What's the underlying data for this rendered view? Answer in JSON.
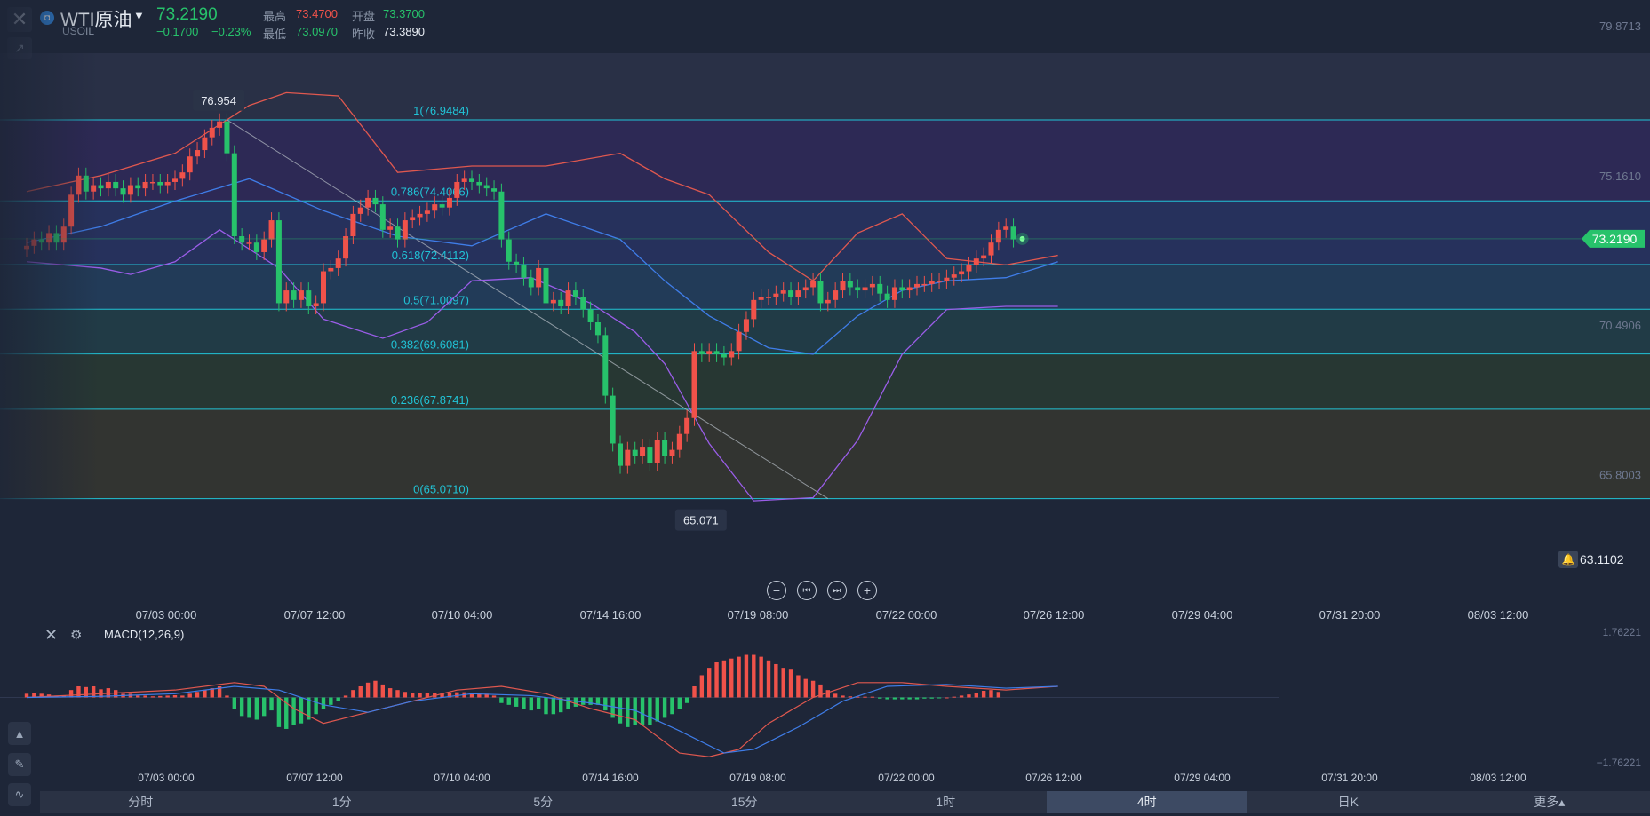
{
  "header": {
    "close_icon": "close-icon",
    "symbol_name": "WTI原油",
    "symbol_code": "USOIL",
    "last_price": "73.2190",
    "change": "−0.1700",
    "change_pct": "−0.23%",
    "high_label": "最高",
    "high_value": "73.4700",
    "open_label": "开盘",
    "open_value": "73.3700",
    "low_label": "最低",
    "low_value": "73.0970",
    "prev_close_label": "昨收",
    "prev_close_value": "73.3890"
  },
  "colors": {
    "up": "#f0524a",
    "down": "#27c26b",
    "bb_mid": "#3f7de8",
    "bb_upper": "#e0584f",
    "bb_lower": "#9a5de8",
    "fib": "#21c3d6",
    "macd_fast": "#3f7de8",
    "macd_slow": "#e0584f"
  },
  "chart_data": [
    {
      "type": "candlestick",
      "symbol": "WTI原油",
      "interval": "4时",
      "ylim": [
        63.1102,
        79.8713
      ],
      "y_axis_labels": [
        "79.8713",
        "75.1610",
        "70.4906",
        "65.8003"
      ],
      "y_axis_values": [
        79.8713,
        75.161,
        70.4906,
        65.8003
      ],
      "current_price_tag": "73.2190",
      "bottom_price_tag": "63.1102",
      "x_axis_labels": [
        "07/03 00:00",
        "07/07 12:00",
        "07/10 04:00",
        "07/14 16:00",
        "07/19 08:00",
        "07/22 00:00",
        "07/26 12:00",
        "07/29 04:00",
        "07/31 20:00",
        "08/03 12:00"
      ],
      "high_marker": "76.954",
      "low_marker": "65.071",
      "fibonacci": [
        {
          "label": "1(76.9484)",
          "value": 76.9484
        },
        {
          "label": "0.786(74.4066)",
          "value": 74.4066
        },
        {
          "label": "0.618(72.4112)",
          "value": 72.4112
        },
        {
          "label": "0.5(71.0097)",
          "value": 71.0097
        },
        {
          "label": "0.382(69.6081)",
          "value": 69.6081
        },
        {
          "label": "0.236(67.8741)",
          "value": 67.8741
        },
        {
          "label": "0(65.0710)",
          "value": 65.071
        }
      ],
      "close": [
        73.0,
        73.2,
        73.1,
        73.4,
        73.1,
        73.6,
        74.6,
        75.2,
        74.7,
        74.9,
        74.8,
        75.0,
        74.8,
        74.6,
        74.9,
        74.8,
        75.0,
        75.0,
        74.9,
        75.0,
        75.1,
        75.3,
        75.8,
        76.0,
        76.4,
        76.7,
        76.9,
        75.9,
        73.3,
        73.1,
        73.1,
        72.8,
        73.2,
        73.8,
        71.2,
        71.6,
        71.3,
        71.6,
        71.1,
        71.2,
        72.2,
        72.3,
        72.6,
        73.3,
        74.0,
        74.2,
        74.5,
        74.3,
        73.5,
        73.6,
        73.2,
        73.8,
        73.9,
        74.0,
        74.1,
        74.3,
        74.2,
        74.5,
        75.0,
        75.1,
        75.0,
        74.9,
        74.8,
        74.7,
        73.2,
        72.5,
        72.4,
        72.0,
        71.7,
        72.3,
        71.2,
        71.3,
        71.1,
        71.6,
        71.4,
        71.0,
        70.6,
        70.2,
        68.3,
        66.8,
        66.1,
        66.6,
        66.4,
        66.7,
        66.2,
        66.9,
        66.4,
        66.6,
        67.1,
        67.6,
        69.7,
        69.6,
        69.7,
        69.6,
        69.5,
        69.7,
        70.3,
        70.7,
        71.3,
        71.4,
        71.4,
        71.5,
        71.6,
        71.4,
        71.6,
        71.7,
        71.9,
        71.2,
        71.3,
        71.6,
        71.9,
        71.7,
        71.6,
        71.7,
        71.8,
        71.5,
        71.3,
        71.7,
        71.6,
        71.7,
        71.8,
        71.8,
        71.9,
        71.9,
        72.0,
        72.1,
        72.2,
        72.4,
        72.6,
        72.7,
        73.1,
        73.5,
        73.6,
        73.2
      ],
      "bollinger": {
        "upper": [
          [
            0,
            74.7
          ],
          [
            10,
            75.2
          ],
          [
            20,
            75.9
          ],
          [
            30,
            77.4
          ],
          [
            35,
            77.8
          ],
          [
            42,
            77.7
          ],
          [
            50,
            75.3
          ],
          [
            60,
            75.5
          ],
          [
            70,
            75.5
          ],
          [
            80,
            75.9
          ],
          [
            86,
            75.1
          ],
          [
            92,
            74.6
          ],
          [
            100,
            72.8
          ],
          [
            106,
            71.9
          ],
          [
            112,
            73.4
          ],
          [
            118,
            74.0
          ],
          [
            124,
            72.6
          ],
          [
            132,
            72.4
          ],
          [
            139,
            72.7
          ]
        ],
        "middle": [
          [
            0,
            73.1
          ],
          [
            10,
            73.6
          ],
          [
            20,
            74.4
          ],
          [
            30,
            75.1
          ],
          [
            40,
            74.1
          ],
          [
            50,
            73.3
          ],
          [
            60,
            73.0
          ],
          [
            70,
            74.0
          ],
          [
            80,
            73.2
          ],
          [
            86,
            71.9
          ],
          [
            92,
            70.8
          ],
          [
            100,
            69.8
          ],
          [
            106,
            69.6
          ],
          [
            112,
            70.8
          ],
          [
            118,
            71.6
          ],
          [
            124,
            71.9
          ],
          [
            132,
            72.0
          ],
          [
            139,
            72.5
          ]
        ],
        "lower": [
          [
            0,
            72.5
          ],
          [
            10,
            72.3
          ],
          [
            14,
            72.1
          ],
          [
            20,
            72.5
          ],
          [
            26,
            73.5
          ],
          [
            34,
            72.3
          ],
          [
            40,
            70.7
          ],
          [
            48,
            70.1
          ],
          [
            54,
            70.6
          ],
          [
            60,
            71.9
          ],
          [
            68,
            72.0
          ],
          [
            76,
            71.2
          ],
          [
            82,
            70.3
          ],
          [
            86,
            69.3
          ],
          [
            92,
            66.8
          ],
          [
            98,
            65.0
          ],
          [
            106,
            65.1
          ],
          [
            112,
            66.9
          ],
          [
            118,
            69.6
          ],
          [
            124,
            71.0
          ],
          [
            132,
            71.1
          ],
          [
            139,
            71.1
          ]
        ]
      },
      "macd": {
        "label": "MACD(12,26,9)",
        "axis_labels": [
          "1.76221",
          "−1.76221"
        ],
        "ylim": [
          -1.76221,
          1.76221
        ],
        "histogram": [
          0.1,
          0.12,
          0.1,
          0.08,
          0.05,
          0.06,
          0.2,
          0.3,
          0.28,
          0.3,
          0.22,
          0.25,
          0.2,
          0.1,
          0.1,
          0.05,
          0.05,
          0.03,
          0.04,
          0.05,
          0.06,
          0.05,
          0.1,
          0.15,
          0.2,
          0.25,
          0.3,
          0.05,
          -0.3,
          -0.5,
          -0.55,
          -0.6,
          -0.5,
          -0.35,
          -0.8,
          -0.85,
          -0.75,
          -0.7,
          -0.6,
          -0.45,
          -0.3,
          -0.2,
          -0.1,
          0.05,
          0.2,
          0.3,
          0.4,
          0.45,
          0.35,
          0.25,
          0.2,
          0.15,
          0.12,
          0.12,
          0.12,
          0.12,
          0.1,
          0.12,
          0.14,
          0.14,
          0.12,
          0.1,
          0.1,
          0.05,
          -0.15,
          -0.2,
          -0.25,
          -0.3,
          -0.35,
          -0.3,
          -0.45,
          -0.45,
          -0.4,
          -0.3,
          -0.25,
          -0.2,
          -0.2,
          -0.2,
          -0.35,
          -0.55,
          -0.7,
          -0.8,
          -0.75,
          -0.75,
          -0.75,
          -0.65,
          -0.55,
          -0.45,
          -0.3,
          -0.15,
          0.3,
          0.6,
          0.8,
          0.95,
          1.0,
          1.05,
          1.1,
          1.15,
          1.15,
          1.1,
          1.0,
          0.9,
          0.8,
          0.75,
          0.6,
          0.5,
          0.45,
          0.35,
          0.2,
          0.1,
          0.05,
          0.03,
          0.02,
          0.02,
          0.02,
          -0.03,
          -0.05,
          -0.05,
          -0.05,
          -0.05,
          -0.05,
          -0.03,
          -0.03,
          -0.02,
          0.0,
          0.02,
          0.05,
          0.08,
          0.12,
          0.18,
          0.2,
          0.15
        ],
        "dif": [
          [
            0,
            0.0
          ],
          [
            10,
            0.1
          ],
          [
            20,
            0.2
          ],
          [
            28,
            0.4
          ],
          [
            32,
            0.3
          ],
          [
            36,
            -0.3
          ],
          [
            40,
            -0.7
          ],
          [
            44,
            -0.5
          ],
          [
            50,
            -0.2
          ],
          [
            58,
            0.2
          ],
          [
            64,
            0.3
          ],
          [
            70,
            0.1
          ],
          [
            76,
            -0.3
          ],
          [
            82,
            -0.6
          ],
          [
            88,
            -1.5
          ],
          [
            92,
            -1.6
          ],
          [
            96,
            -1.4
          ],
          [
            100,
            -0.7
          ],
          [
            106,
            0.0
          ],
          [
            112,
            0.4
          ],
          [
            118,
            0.4
          ],
          [
            124,
            0.3
          ],
          [
            132,
            0.2
          ],
          [
            139,
            0.3
          ]
        ],
        "dea": [
          [
            0,
            0.0
          ],
          [
            10,
            0.03
          ],
          [
            20,
            0.1
          ],
          [
            28,
            0.3
          ],
          [
            34,
            0.2
          ],
          [
            40,
            -0.2
          ],
          [
            46,
            -0.4
          ],
          [
            52,
            -0.1
          ],
          [
            60,
            0.1
          ],
          [
            68,
            0.05
          ],
          [
            76,
            -0.15
          ],
          [
            82,
            -0.35
          ],
          [
            88,
            -0.9
          ],
          [
            94,
            -1.5
          ],
          [
            98,
            -1.4
          ],
          [
            104,
            -0.8
          ],
          [
            110,
            -0.1
          ],
          [
            116,
            0.3
          ],
          [
            124,
            0.35
          ],
          [
            132,
            0.25
          ],
          [
            139,
            0.3
          ]
        ]
      }
    }
  ],
  "chart_nav": {
    "zoom_out": "−",
    "prev": "⏮",
    "next": "⏭",
    "zoom_in": "+"
  },
  "side_tools": {
    "tool1": "▲",
    "tool2": "✎",
    "tool3": "∿"
  },
  "timeframes": [
    "分时",
    "1分",
    "5分",
    "15分",
    "1时",
    "4时",
    "日K",
    "更多▴"
  ],
  "active_timeframe": 5
}
